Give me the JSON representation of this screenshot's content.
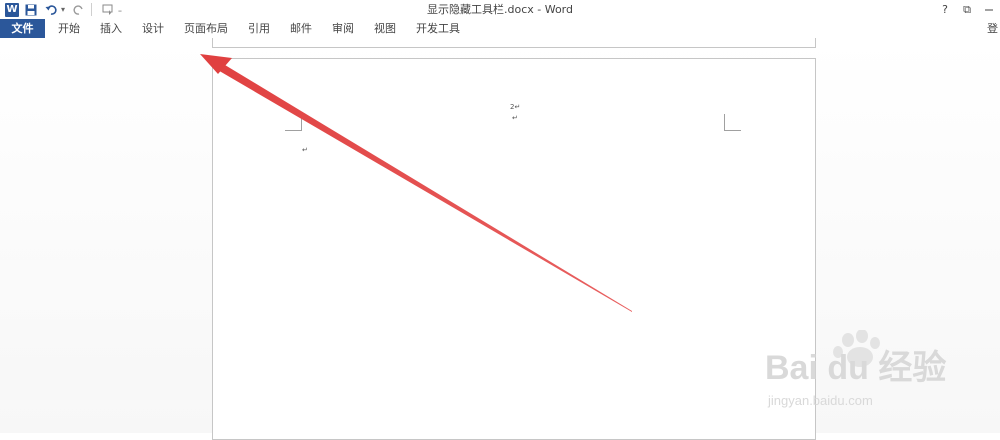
{
  "titlebar": {
    "doc_title": "显示隐藏工具栏.docx - Word",
    "help": "?",
    "restore": "⧉"
  },
  "ribbon": {
    "tabs": [
      {
        "label": "文件"
      },
      {
        "label": "开始"
      },
      {
        "label": "插入"
      },
      {
        "label": "设计"
      },
      {
        "label": "页面布局"
      },
      {
        "label": "引用"
      },
      {
        "label": "邮件"
      },
      {
        "label": "审阅"
      },
      {
        "label": "视图"
      },
      {
        "label": "开发工具"
      }
    ],
    "account_glyph": "登"
  },
  "document": {
    "page_number": "2↵",
    "paragraph_mark": "↵"
  },
  "watermark": {
    "text": "Bai du 经验",
    "sub": "jingyan.baidu.com"
  },
  "colors": {
    "accent": "#2b579a",
    "arrow": "#e04545"
  }
}
